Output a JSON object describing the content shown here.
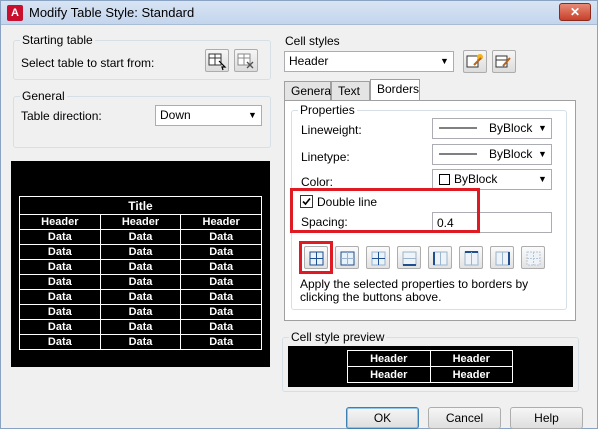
{
  "window": {
    "title": "Modify Table Style: Standard",
    "app_icon": "A",
    "close_glyph": "✕"
  },
  "starting_table": {
    "label": "Starting table",
    "prompt": "Select table to start from:"
  },
  "general": {
    "label": "General",
    "direction_label": "Table direction:",
    "direction_value": "Down"
  },
  "table_preview": {
    "title": "Title",
    "headers": [
      "Header",
      "Header",
      "Header"
    ],
    "data_rows": 8,
    "data_cell": "Data"
  },
  "cell_styles": {
    "label": "Cell styles",
    "selected": "Header"
  },
  "tabs": [
    {
      "label": "General"
    },
    {
      "label": "Text"
    },
    {
      "label": "Borders"
    }
  ],
  "borders": {
    "properties_label": "Properties",
    "lineweight_label": "Lineweight:",
    "lineweight_value": "ByBlock",
    "linetype_label": "Linetype:",
    "linetype_value": "ByBlock",
    "color_label": "Color:",
    "color_value": "ByBlock",
    "double_line_label": "Double line",
    "double_line_checked": true,
    "spacing_label": "Spacing:",
    "spacing_value": "0.4",
    "apply_text": "Apply the selected properties to borders by clicking the buttons above."
  },
  "cell_preview": {
    "label": "Cell style preview",
    "cells": [
      "Header",
      "Header",
      "Header",
      "Header"
    ]
  },
  "buttons": {
    "ok": "OK",
    "cancel": "Cancel",
    "help": "Help"
  },
  "colors": {
    "highlight_box": "#e01a22",
    "preview_bg": "#000000"
  }
}
